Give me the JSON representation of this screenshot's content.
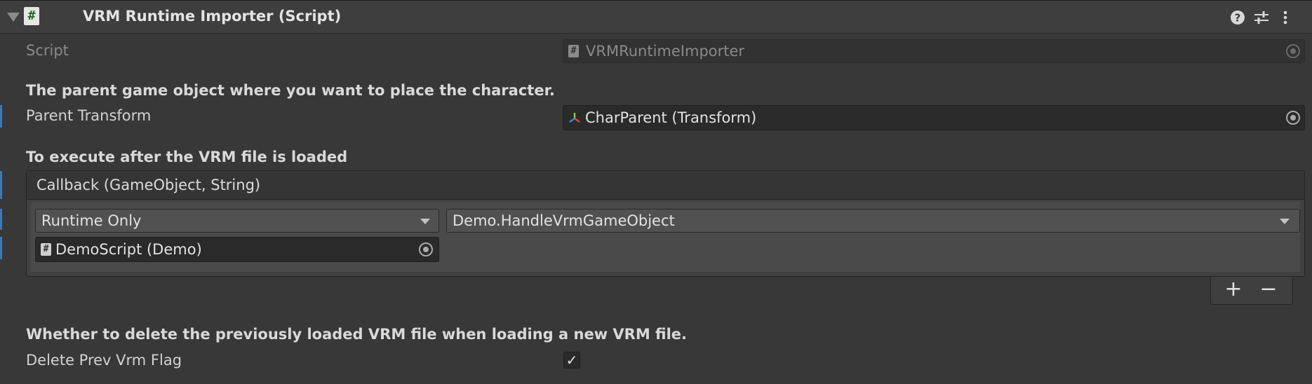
{
  "component": {
    "title": "VRM Runtime Importer (Script)",
    "script_label": "Script",
    "script_value": "VRMRuntimeImporter"
  },
  "parent": {
    "header": "The parent game object where you want to place the character.",
    "label": "Parent Transform",
    "value": "CharParent (Transform)"
  },
  "callback": {
    "header": "To execute after the VRM file is loaded",
    "event_title": "Callback (GameObject, String)",
    "runtime_mode": "Runtime Only",
    "function": "Demo.HandleVrmGameObject",
    "target": "DemoScript (Demo)",
    "add_label": "+",
    "remove_label": "−"
  },
  "delete_flag": {
    "header": "Whether to delete the previously loaded VRM file when loading a new VRM file.",
    "label": "Delete Prev Vrm Flag",
    "checked": true,
    "check_glyph": "✓"
  },
  "icons": {
    "script_glyph": "#",
    "help": "help-icon",
    "presets": "presets-icon",
    "menu": "kebab-menu-icon",
    "transform": "transform-icon",
    "foldout": "foldout-arrow-icon",
    "object_picker": "object-picker-icon"
  },
  "colors": {
    "background": "#383838",
    "header_background": "#3e3e3e",
    "field_background": "#2a2a2a",
    "accent_bar": "#3a79bb"
  }
}
